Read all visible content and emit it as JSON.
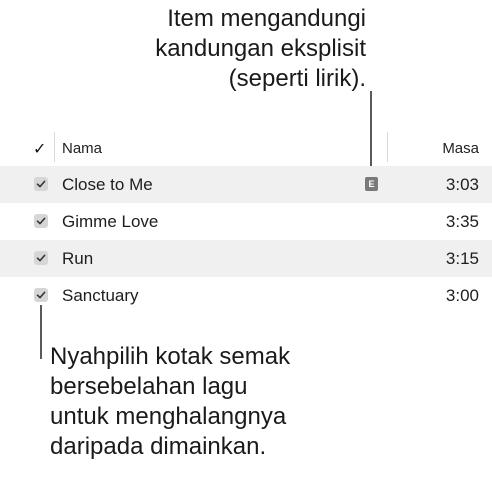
{
  "callouts": {
    "explicit": {
      "lines": [
        "Item mengandungi",
        "kandungan eksplisit",
        "(seperti lirik)."
      ]
    },
    "uncheck": {
      "lines": [
        "Nyahpilih kotak semak",
        "bersebelahan lagu",
        "untuk menghalangnya",
        "daripada dimainkan."
      ]
    }
  },
  "table": {
    "columns": {
      "check": "✓",
      "name": "Nama",
      "time": "Masa"
    },
    "rows": [
      {
        "title": "Close to Me",
        "time": "3:03",
        "checked": true,
        "explicit": true,
        "explicit_badge": "E"
      },
      {
        "title": "Gimme Love",
        "time": "3:35",
        "checked": true,
        "explicit": false
      },
      {
        "title": "Run",
        "time": "3:15",
        "checked": true,
        "explicit": false
      },
      {
        "title": "Sanctuary",
        "time": "3:00",
        "checked": true,
        "explicit": false
      }
    ]
  }
}
